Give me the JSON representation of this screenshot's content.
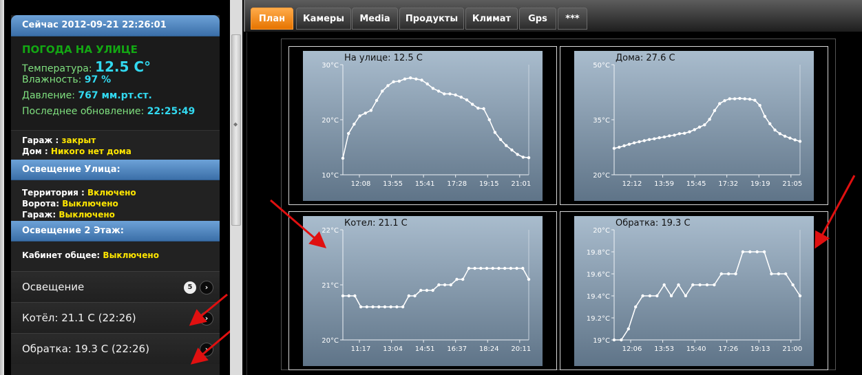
{
  "sidebar": {
    "header": "Сейчас 2012-09-21 22:26:01",
    "weather_title": "ПОГОДА НА УЛИЦЕ",
    "temp_label": "Температура:",
    "temp_value": "12.5 C°",
    "humidity_label": "Влажность:",
    "humidity_value": "97 %",
    "pressure_label": "Давление:",
    "pressure_value": "767 мм.рт.ст.",
    "updated_label": "Последнее обновление:",
    "updated_value": "22:25:49",
    "garage_label": "Гараж :",
    "garage_value": "закрыт",
    "home_label": "Дом :",
    "home_value": "Никого нет дома",
    "street_light_header": "Освещение Улица:",
    "territory_label": "Территория :",
    "territory_value": "Включено",
    "gate_label": "Ворота:",
    "gate_value": "Выключено",
    "garage_light_label": "Гараж:",
    "garage_light_value": "Выключено",
    "floor2_header": "Освещение 2 Этаж:",
    "cabinet_label": "Кабинет общее:",
    "cabinet_value": "Выключено",
    "items": [
      {
        "label": "Освещение",
        "count": "5"
      },
      {
        "label": "Котёл: 21.1 C (22:26)"
      },
      {
        "label": "Обратка: 19.3 C (22:26)"
      }
    ]
  },
  "tabs": [
    "План",
    "Камеры",
    "Media",
    "Продукты",
    "Климат",
    "Gps",
    "***"
  ],
  "active_tab": "План",
  "colors": {
    "accent": "#ff8a00",
    "header_blue": "#4a80bd",
    "value_cyan": "#32d9f0",
    "status_yellow": "#ffe600",
    "weather_green": "#13a813"
  },
  "chart_data": [
    {
      "type": "line",
      "title": "На улице:  12.5  C",
      "ylim": [
        10,
        30
      ],
      "yticks": [
        "10°C",
        "20°C",
        "30°C"
      ],
      "xticks": [
        "12:08",
        "13:55",
        "15:41",
        "17:28",
        "19:15",
        "21:01"
      ],
      "values": [
        13,
        17.5,
        19.2,
        20.7,
        21.2,
        21.7,
        23.5,
        25.2,
        26.2,
        26.9,
        27,
        27.4,
        27.6,
        27.4,
        27.2,
        26.5,
        25.7,
        25.2,
        24.7,
        24.7,
        24.5,
        24.1,
        23.6,
        22.8,
        22.1,
        22,
        20,
        17.7,
        16.4,
        15.3,
        14.5,
        13.7,
        13.2,
        13.1
      ]
    },
    {
      "type": "line",
      "title": "Дома:  27.6  C",
      "ylim": [
        20,
        50
      ],
      "yticks": [
        "20°C",
        "35°C",
        "50°C"
      ],
      "xticks": [
        "12:12",
        "13:59",
        "15:45",
        "17:32",
        "19:19",
        "21:05"
      ],
      "values": [
        27.2,
        27.5,
        27.9,
        28.3,
        28.7,
        29,
        29.3,
        29.6,
        29.8,
        30.1,
        30.3,
        30.6,
        30.8,
        31.2,
        31.3,
        31.7,
        32.3,
        33,
        33.6,
        35.1,
        37.5,
        39.4,
        40.2,
        40.7,
        40.7,
        40.8,
        40.7,
        40.6,
        40.3,
        38.9,
        35.9,
        33.9,
        32.2,
        31.2,
        30.5,
        30,
        29.5,
        29.1
      ]
    },
    {
      "type": "line",
      "title": "Котел:  21.1  C",
      "ylim": [
        20,
        22
      ],
      "yticks": [
        "20°C",
        "21°C",
        "22°C"
      ],
      "xticks": [
        "11:17",
        "13:04",
        "14:51",
        "16:37",
        "18:24",
        "20:11"
      ],
      "values": [
        20.8,
        20.8,
        20.8,
        20.6,
        20.6,
        20.6,
        20.6,
        20.6,
        20.6,
        20.6,
        20.6,
        20.8,
        20.8,
        20.9,
        20.9,
        20.9,
        21,
        21,
        21,
        21.1,
        21.1,
        21.3,
        21.3,
        21.3,
        21.3,
        21.3,
        21.3,
        21.3,
        21.3,
        21.3,
        21.3,
        21.1
      ]
    },
    {
      "type": "line",
      "title": "Обратка:  19.3  C",
      "ylim": [
        19,
        20
      ],
      "yticks": [
        "19°C",
        "19.2°C",
        "19.4°C",
        "19.6°C",
        "19.8°C",
        "20°C"
      ],
      "xticks": [
        "12:06",
        "13:53",
        "15:40",
        "17:26",
        "19:13",
        "21:00"
      ],
      "values": [
        19,
        19,
        19.1,
        19.3,
        19.4,
        19.4,
        19.4,
        19.5,
        19.4,
        19.5,
        19.4,
        19.5,
        19.5,
        19.5,
        19.5,
        19.6,
        19.6,
        19.6,
        19.8,
        19.8,
        19.8,
        19.8,
        19.6,
        19.6,
        19.6,
        19.5,
        19.4
      ]
    }
  ]
}
